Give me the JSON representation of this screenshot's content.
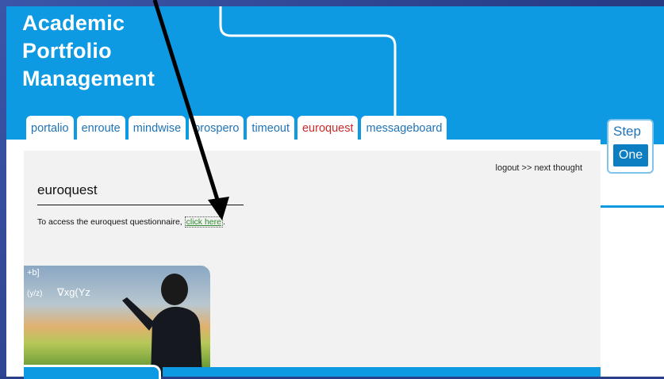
{
  "header": {
    "title_lines": [
      "Academic",
      "Portfolio",
      "Management"
    ]
  },
  "tabs": [
    {
      "label": "portalio"
    },
    {
      "label": "enroute"
    },
    {
      "label": "mindwise"
    },
    {
      "label": "prospero"
    },
    {
      "label": "timeout"
    },
    {
      "label": "euroquest",
      "active": true
    },
    {
      "label": "messageboard"
    }
  ],
  "logo": {
    "step": "Step",
    "one": "One"
  },
  "content": {
    "logout_link": "logout >> next thought",
    "heading": "euroquest",
    "description_prefix": "To access the euroquest questionnaire, ",
    "link_text": "click here",
    "description_suffix": "."
  },
  "hero_image": {
    "overlay_text": [
      "+b]",
      "(y/z)",
      "∇xg(Yz"
    ]
  },
  "colors": {
    "header_blue": "#0d9ae3",
    "tab_text": "#1f73b8",
    "active_tab_text": "#cc2b2b",
    "link_green": "#2f8a2f",
    "content_bg": "#f2f2f2"
  }
}
